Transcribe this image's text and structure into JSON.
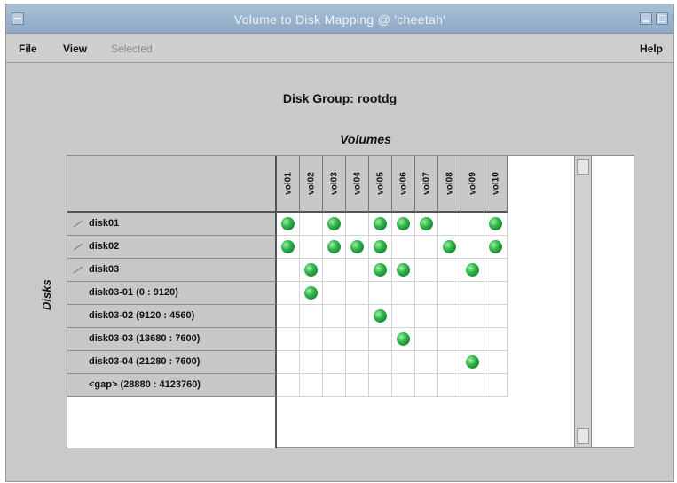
{
  "window": {
    "title": "Volume to Disk Mapping @ 'cheetah'"
  },
  "menu": {
    "file": "File",
    "view": "View",
    "selected": "Selected",
    "help": "Help"
  },
  "heading": "Disk Group: rootdg",
  "volumes_label": "Volumes",
  "disks_label": "Disks",
  "volumes": [
    "vol01",
    "vol02",
    "vol03",
    "vol04",
    "vol05",
    "vol06",
    "vol07",
    "vol08",
    "vol09",
    "vol10"
  ],
  "rows": [
    {
      "label": "disk01",
      "kind": "disk",
      "marks": [
        1,
        0,
        1,
        0,
        1,
        1,
        1,
        0,
        0,
        1
      ]
    },
    {
      "label": "disk02",
      "kind": "disk",
      "marks": [
        1,
        0,
        1,
        1,
        1,
        0,
        0,
        1,
        0,
        1
      ]
    },
    {
      "label": "disk03",
      "kind": "disk",
      "marks": [
        0,
        1,
        0,
        0,
        1,
        1,
        0,
        0,
        1,
        0
      ]
    },
    {
      "label": "disk03-01 (0 : 9120)",
      "kind": "sub",
      "marks": [
        0,
        1,
        0,
        0,
        0,
        0,
        0,
        0,
        0,
        0
      ]
    },
    {
      "label": "disk03-02 (9120 : 4560)",
      "kind": "sub",
      "marks": [
        0,
        0,
        0,
        0,
        1,
        0,
        0,
        0,
        0,
        0
      ]
    },
    {
      "label": "disk03-03 (13680 : 7600)",
      "kind": "sub",
      "marks": [
        0,
        0,
        0,
        0,
        0,
        1,
        0,
        0,
        0,
        0
      ]
    },
    {
      "label": "disk03-04 (21280 : 7600)",
      "kind": "sub",
      "marks": [
        0,
        0,
        0,
        0,
        0,
        0,
        0,
        0,
        1,
        0
      ]
    },
    {
      "label": "<gap> (28880 : 4123760)",
      "kind": "sub",
      "marks": [
        0,
        0,
        0,
        0,
        0,
        0,
        0,
        0,
        0,
        0
      ]
    }
  ],
  "colors": {
    "titlebar": "#97b0cb",
    "mapped_dot": "#2eb54a",
    "background": "#c9c9c9"
  },
  "icons": {
    "mapped": "green-sphere-icon",
    "expander": "tree-expander-icon"
  }
}
